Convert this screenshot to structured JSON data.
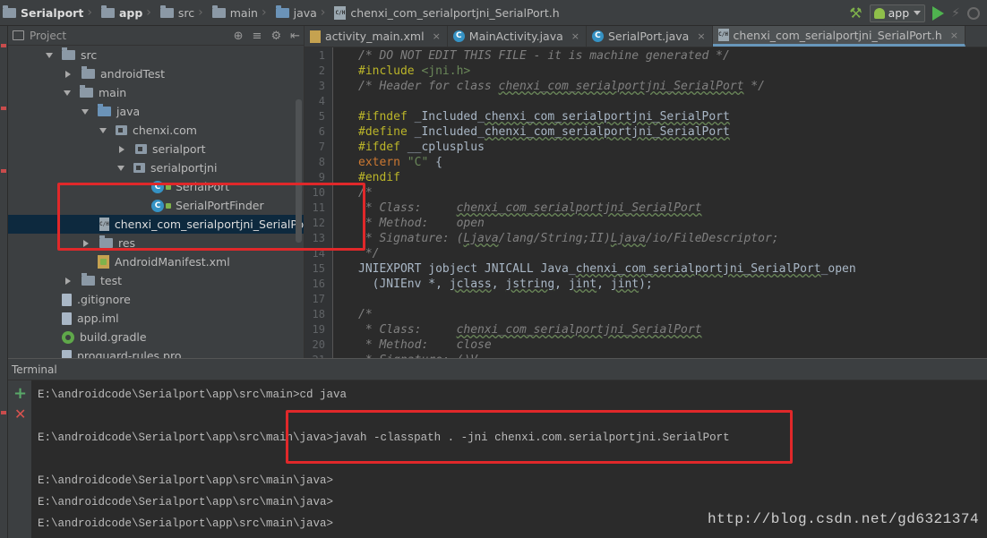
{
  "breadcrumbs": [
    {
      "label": "Serialport",
      "bold": true,
      "icon": "folder-icon"
    },
    {
      "label": "app",
      "bold": true,
      "icon": "folder-icon"
    },
    {
      "label": "src",
      "icon": "folder-icon"
    },
    {
      "label": "main",
      "icon": "folder-icon"
    },
    {
      "label": "java",
      "icon": "folder-icon"
    },
    {
      "label": "chenxi_com_serialportjni_SerialPort.h",
      "icon": "h-file-icon"
    }
  ],
  "run_config": {
    "label": "app"
  },
  "project_panel": {
    "title": "Project",
    "tree": [
      {
        "label": "src",
        "level": 2,
        "arrow": "down",
        "icon": "folder"
      },
      {
        "label": "androidTest",
        "level": 3,
        "arrow": "right",
        "icon": "folder"
      },
      {
        "label": "main",
        "level": 3,
        "arrow": "down",
        "icon": "folder"
      },
      {
        "label": "java",
        "level": 4,
        "arrow": "down",
        "icon": "folder-blue"
      },
      {
        "label": "chenxi.com",
        "level": 5,
        "arrow": "down",
        "icon": "package"
      },
      {
        "label": "serialport",
        "level": 6,
        "arrow": "right",
        "icon": "package"
      },
      {
        "label": "serialportjni",
        "level": 6,
        "arrow": "down",
        "icon": "package"
      },
      {
        "label": "SerialPort",
        "level": 7,
        "arrow": "none",
        "icon": "class"
      },
      {
        "label": "SerialPortFinder",
        "level": 7,
        "arrow": "none",
        "icon": "class"
      },
      {
        "label": "chenxi_com_serialportjni_SerialPo",
        "level": 5,
        "arrow": "none",
        "icon": "hfile",
        "selected": true
      },
      {
        "label": "res",
        "level": 4,
        "arrow": "right",
        "icon": "folder"
      },
      {
        "label": "AndroidManifest.xml",
        "level": 4,
        "arrow": "none",
        "icon": "xml"
      },
      {
        "label": "test",
        "level": 3,
        "arrow": "right",
        "icon": "folder"
      },
      {
        "label": ".gitignore",
        "level": 2,
        "arrow": "none",
        "icon": "file"
      },
      {
        "label": "app.iml",
        "level": 2,
        "arrow": "none",
        "icon": "file"
      },
      {
        "label": "build.gradle",
        "level": 2,
        "arrow": "none",
        "icon": "gradle"
      },
      {
        "label": "proguard-rules.pro",
        "level": 2,
        "arrow": "none",
        "icon": "file"
      }
    ]
  },
  "editor": {
    "tabs": [
      {
        "label": "activity_main.xml",
        "icon": "xml"
      },
      {
        "label": "MainActivity.java",
        "icon": "class"
      },
      {
        "label": "SerialPort.java",
        "icon": "class"
      },
      {
        "label": "chenxi_com_serialportjni_SerialPort.h",
        "icon": "h",
        "active": true
      }
    ],
    "lines": [
      {
        "n": "1",
        "parts": [
          {
            "t": "/* DO NOT EDIT THIS FILE - it is machine generated */",
            "c": "c-comment"
          }
        ]
      },
      {
        "n": "2",
        "parts": [
          {
            "t": "#include ",
            "c": "c-pp"
          },
          {
            "t": "<jni.h>",
            "c": "c-str"
          }
        ]
      },
      {
        "n": "3",
        "parts": [
          {
            "t": "/* Header for class ",
            "c": "c-comment"
          },
          {
            "t": "chenxi_com_serialportjni_SerialPort",
            "c": "c-comment c-under"
          },
          {
            "t": " */",
            "c": "c-comment"
          }
        ]
      },
      {
        "n": "4",
        "parts": []
      },
      {
        "n": "5",
        "parts": [
          {
            "t": "#ifndef ",
            "c": "c-pp"
          },
          {
            "t": "_Included_",
            "c": "c-id"
          },
          {
            "t": "chenxi_com_serialportjni_SerialPort",
            "c": "c-id c-under"
          }
        ]
      },
      {
        "n": "6",
        "parts": [
          {
            "t": "#define ",
            "c": "c-pp"
          },
          {
            "t": "_Included_",
            "c": "c-id"
          },
          {
            "t": "chenxi_com_serialportjni_SerialPort",
            "c": "c-id c-under"
          }
        ]
      },
      {
        "n": "7",
        "parts": [
          {
            "t": "#ifdef ",
            "c": "c-pp"
          },
          {
            "t": "__cplusplus",
            "c": "c-id"
          }
        ]
      },
      {
        "n": "8",
        "parts": [
          {
            "t": "extern ",
            "c": "c-kw"
          },
          {
            "t": "\"C\"",
            "c": "c-str"
          },
          {
            "t": " {",
            "c": "c-id"
          }
        ]
      },
      {
        "n": "9",
        "parts": [
          {
            "t": "#endif",
            "c": "c-pp"
          }
        ]
      },
      {
        "n": "10",
        "parts": [
          {
            "t": "/*",
            "c": "c-comment"
          }
        ]
      },
      {
        "n": "11",
        "parts": [
          {
            "t": " * Class:     ",
            "c": "c-comment"
          },
          {
            "t": "chenxi_com_serialportjni_SerialPort",
            "c": "c-comment c-under"
          }
        ]
      },
      {
        "n": "12",
        "parts": [
          {
            "t": " * Method:    open",
            "c": "c-comment"
          }
        ]
      },
      {
        "n": "13",
        "parts": [
          {
            "t": " * Signature: (",
            "c": "c-comment"
          },
          {
            "t": "Ljava",
            "c": "c-comment c-under"
          },
          {
            "t": "/lang/String;II)",
            "c": "c-comment"
          },
          {
            "t": "Ljava",
            "c": "c-comment c-under"
          },
          {
            "t": "/io/FileDescriptor;",
            "c": "c-comment"
          }
        ]
      },
      {
        "n": "14",
        "parts": [
          {
            "t": " */",
            "c": "c-comment"
          }
        ]
      },
      {
        "n": "15",
        "parts": [
          {
            "t": "JNIEXPORT jobject JNICALL Java_",
            "c": "c-id"
          },
          {
            "t": "chenxi_com_serialportjni_SerialPort",
            "c": "c-id c-under"
          },
          {
            "t": "_open",
            "c": "c-id"
          }
        ]
      },
      {
        "n": "16",
        "parts": [
          {
            "t": "  (JNIEnv *, ",
            "c": "c-id"
          },
          {
            "t": "jclass",
            "c": "c-id c-under"
          },
          {
            "t": ", ",
            "c": "c-id"
          },
          {
            "t": "jstring",
            "c": "c-id c-under"
          },
          {
            "t": ", ",
            "c": "c-id"
          },
          {
            "t": "jint",
            "c": "c-id c-under"
          },
          {
            "t": ", ",
            "c": "c-id"
          },
          {
            "t": "jint",
            "c": "c-id c-under"
          },
          {
            "t": ");",
            "c": "c-id"
          }
        ]
      },
      {
        "n": "17",
        "parts": []
      },
      {
        "n": "18",
        "parts": [
          {
            "t": "/*",
            "c": "c-comment"
          }
        ]
      },
      {
        "n": "19",
        "parts": [
          {
            "t": " * Class:     ",
            "c": "c-comment"
          },
          {
            "t": "chenxi_com_serialportjni_SerialPort",
            "c": "c-comment c-under"
          }
        ]
      },
      {
        "n": "20",
        "parts": [
          {
            "t": " * Method:    close",
            "c": "c-comment"
          }
        ]
      },
      {
        "n": "21",
        "parts": [
          {
            "t": " * Signature: ()V",
            "c": "c-comment"
          }
        ]
      }
    ]
  },
  "terminal": {
    "title": "Terminal",
    "lines": [
      "E:\\androidcode\\Serialport\\app\\src\\main>cd java",
      "E:\\androidcode\\Serialport\\app\\src\\main\\java>javah -classpath . -jni chenxi.com.serialportjni.SerialPort",
      "E:\\androidcode\\Serialport\\app\\src\\main\\java>",
      "E:\\androidcode\\Serialport\\app\\src\\main\\java>",
      "E:\\androidcode\\Serialport\\app\\src\\main\\java>"
    ]
  },
  "watermark": "http://blog.csdn.net/gd6321374",
  "colors": {
    "highlight_box": "#e0282a",
    "selection": "#0d293e",
    "accent": "#6897bb"
  }
}
